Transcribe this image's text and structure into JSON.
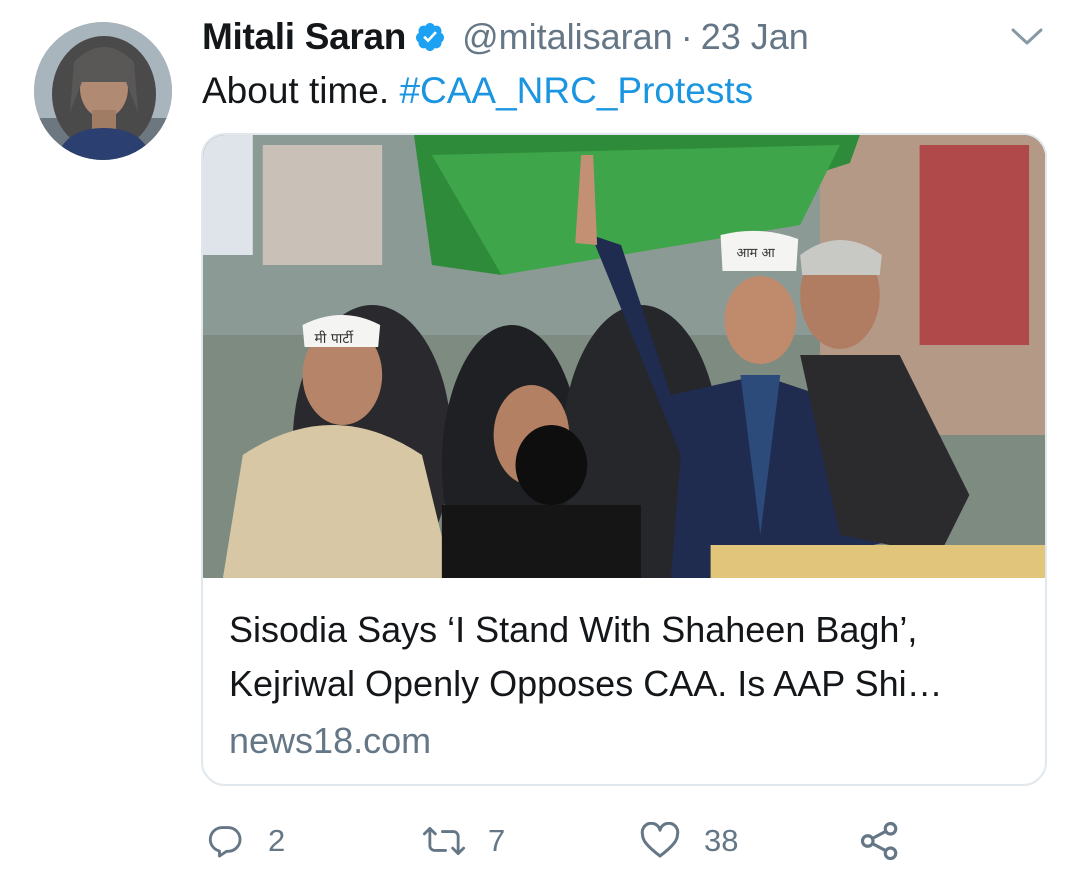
{
  "tweet": {
    "author_name": "Mitali Saran",
    "handle": "@mitalisaran",
    "separator": "·",
    "date": "23 Jan",
    "text_plain": "About time.",
    "hashtag": "#CAA_NRC_Protests"
  },
  "card": {
    "title_line1": "Sisodia Says ‘I Stand With Shaheen Bagh’,",
    "title_line2": "Kejriwal Openly Opposes CAA. Is AAP Shi…",
    "domain": "news18.com",
    "image_cap_text_left": "मी पार्टी",
    "image_cap_text_right": "आम आ"
  },
  "actions": {
    "reply_count": "2",
    "retweet_count": "7",
    "like_count": "38"
  },
  "icons": {
    "verified": "verified-badge-icon",
    "caret": "chevron-down-icon",
    "reply": "reply-icon",
    "retweet": "retweet-icon",
    "like": "heart-icon",
    "share": "share-icon"
  },
  "colors": {
    "text": "#14171a",
    "secondary": "#657786",
    "link": "#1b95e0",
    "verified": "#1da1f2",
    "border": "#e1e8ed"
  }
}
